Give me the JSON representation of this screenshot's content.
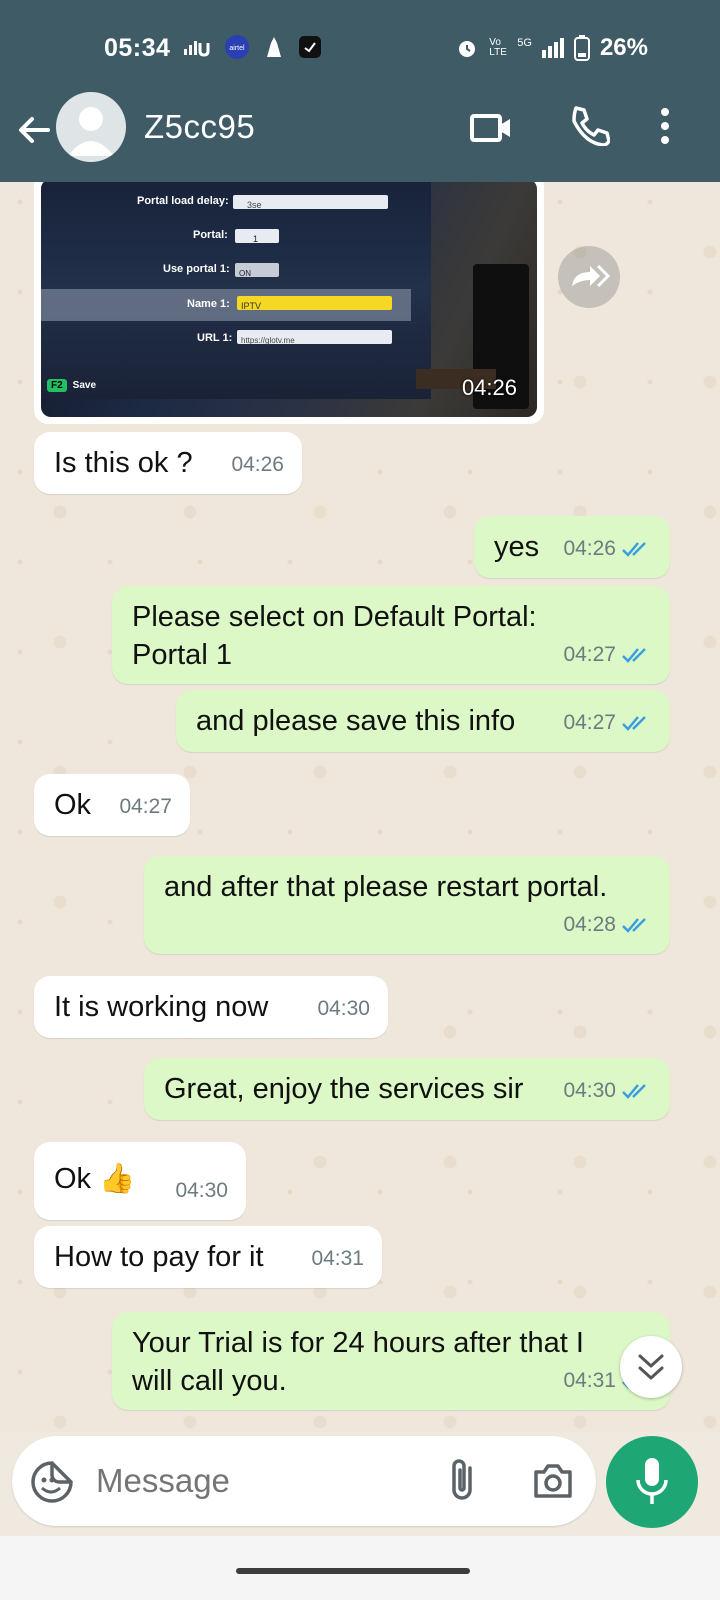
{
  "status_bar": {
    "time": "05:34",
    "battery_percent": "26%",
    "network": "5G",
    "volte": "Vo LTE",
    "icons": [
      "signal-icon",
      "carrier-icon",
      "notification-icon",
      "clock-app-icon",
      "alarm-icon",
      "battery-icon"
    ]
  },
  "header": {
    "contact_name": "Z5cc95",
    "icons": [
      "back-arrow-icon",
      "avatar",
      "video-call-icon",
      "voice-call-icon",
      "more-options-icon"
    ]
  },
  "image_message": {
    "time": "04:26",
    "screen_rows": [
      {
        "label": "Portal load delay:",
        "value": "3se"
      },
      {
        "label": "Portal:",
        "value": "1"
      },
      {
        "label": "Use portal 1:",
        "value": "ON"
      },
      {
        "label": "Name 1:",
        "value": "IPTV"
      },
      {
        "label": "URL 1:",
        "value": "https://glotv.me"
      }
    ],
    "save_key": "F2",
    "save_label": "Save"
  },
  "messages": [
    {
      "dir": "in",
      "text": "Is this ok ?",
      "time": "04:26"
    },
    {
      "dir": "out",
      "text": "yes",
      "time": "04:26"
    },
    {
      "dir": "out",
      "text": "Please select on Default Portal: Portal 1",
      "time": "04:27"
    },
    {
      "dir": "out",
      "text": "and please save this info",
      "time": "04:27"
    },
    {
      "dir": "in",
      "text": "Ok",
      "time": "04:27"
    },
    {
      "dir": "out",
      "text": "and after that please restart portal.",
      "time": "04:28"
    },
    {
      "dir": "in",
      "text": "It is working now",
      "time": "04:30"
    },
    {
      "dir": "out",
      "text": "Great, enjoy the services sir",
      "time": "04:30"
    },
    {
      "dir": "in",
      "text": "Ok 👍",
      "time": "04:30"
    },
    {
      "dir": "in",
      "text": "How to pay for it",
      "time": "04:31"
    },
    {
      "dir": "out",
      "text": "Your Trial is for 24 hours after that I will call you.",
      "time": "04:31"
    }
  ],
  "input": {
    "placeholder": "Message"
  },
  "colors": {
    "header_bg": "#3f5b66",
    "outgoing_bubble": "#dcf8c6",
    "incoming_bubble": "#ffffff",
    "mic_button": "#1ea675",
    "read_ticks": "#3a9fe0"
  }
}
